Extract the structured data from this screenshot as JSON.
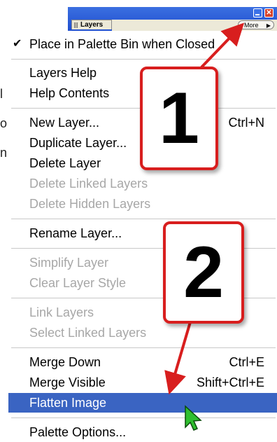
{
  "palette": {
    "tab_label": "Layers",
    "more_label": "More",
    "close_glyph": "✕"
  },
  "menu": {
    "items": [
      {
        "label": "Place in Palette Bin when Closed",
        "checked": true,
        "shortcut": "",
        "enabled": true
      },
      {
        "label": "Layers Help",
        "shortcut": "",
        "enabled": true
      },
      {
        "label": "Help Contents",
        "shortcut": "",
        "enabled": true
      },
      {
        "label": "New Layer...",
        "shortcut": "Ctrl+N",
        "enabled": true
      },
      {
        "label": "Duplicate Layer...",
        "shortcut": "",
        "enabled": true
      },
      {
        "label": "Delete Layer",
        "shortcut": "",
        "enabled": true
      },
      {
        "label": "Delete Linked Layers",
        "shortcut": "",
        "enabled": false
      },
      {
        "label": "Delete Hidden Layers",
        "shortcut": "",
        "enabled": false
      },
      {
        "label": "Rename Layer...",
        "shortcut": "",
        "enabled": true
      },
      {
        "label": "Simplify Layer",
        "shortcut": "",
        "enabled": false
      },
      {
        "label": "Clear Layer Style",
        "shortcut": "",
        "enabled": false
      },
      {
        "label": "Link Layers",
        "shortcut": "",
        "enabled": false
      },
      {
        "label": "Select Linked Layers",
        "shortcut": "",
        "enabled": false
      },
      {
        "label": "Merge Down",
        "shortcut": "Ctrl+E",
        "enabled": true
      },
      {
        "label": "Merge Visible",
        "shortcut": "Shift+Ctrl+E",
        "enabled": true
      },
      {
        "label": "Flatten Image",
        "shortcut": "",
        "enabled": true,
        "selected": true
      },
      {
        "label": "Palette Options...",
        "shortcut": "",
        "enabled": true
      }
    ],
    "check_glyph": "✔"
  },
  "callouts": {
    "step1": "1",
    "step2": "2"
  },
  "edge_fragments": [
    "l",
    "o",
    "n"
  ],
  "colors": {
    "callout_border": "#d81e1e",
    "selection": "#3a64c2",
    "disabled_text": "#a7a7a7",
    "cursor": "#2fbf2f"
  }
}
